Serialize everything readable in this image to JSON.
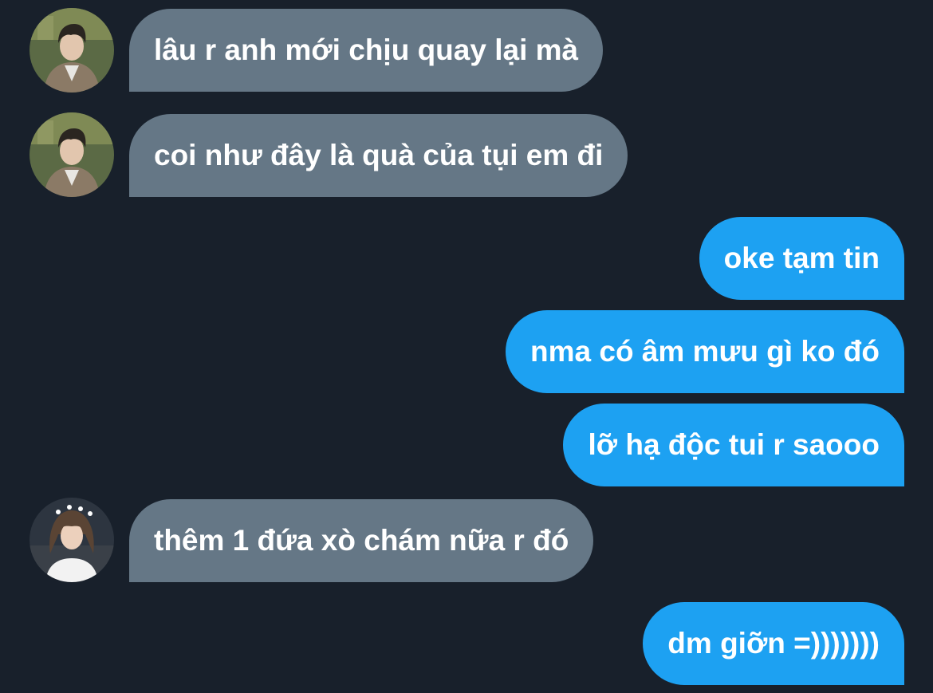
{
  "conversation": {
    "messages": [
      {
        "direction": "incoming",
        "avatar": "avatar-man-jacket",
        "text": "lâu r anh mới chịu quay lại mà"
      },
      {
        "direction": "incoming",
        "avatar": "avatar-man-jacket",
        "text": "coi như đây là quà của tụi em đi"
      },
      {
        "direction": "outgoing",
        "text": "oke tạm tin"
      },
      {
        "direction": "outgoing",
        "text": "nma có âm mưu gì ko đó"
      },
      {
        "direction": "outgoing",
        "text": "lỡ hạ độc tui r saooo"
      },
      {
        "direction": "incoming",
        "avatar": "avatar-long-hair-flower-crown",
        "text": "thêm 1 đứa xò chám nữa r đó"
      },
      {
        "direction": "outgoing",
        "text": "dm giỡn =)))))))"
      }
    ]
  },
  "colors": {
    "background": "#18202b",
    "incoming_bubble": "#657786",
    "outgoing_bubble": "#1da1f2",
    "text": "#ffffff"
  }
}
